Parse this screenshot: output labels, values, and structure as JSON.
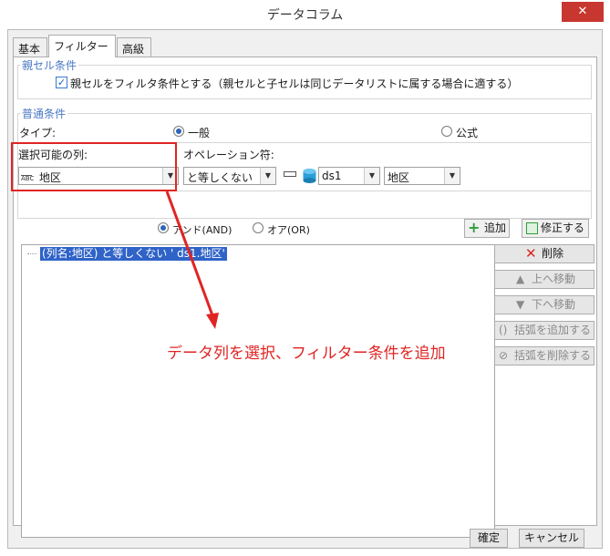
{
  "window": {
    "title": "データコラム",
    "close_glyph": "✕"
  },
  "tabs": [
    {
      "label": "基本"
    },
    {
      "label": "フィルター"
    },
    {
      "label": "高級"
    }
  ],
  "parent_cell": {
    "group_label": "親セル条件",
    "checkbox_checked": true,
    "checkbox_label": "親セルをフィルタ条件とする（親セルと子セルは同じデータリストに属する場合に適する）"
  },
  "normal": {
    "group_label": "普通条件",
    "type_label": "タイプ:",
    "type_general": "一般",
    "type_formula": "公式",
    "selected_type": "一般",
    "column_label": "選択可能の列:",
    "column_value": "地区",
    "column_icon_text": "ABC",
    "operator_label": "オペレーション符:",
    "operator_value": "と等しくない",
    "dataset_value": "ds1",
    "field_value": "地区"
  },
  "logic": {
    "and_label": "アンド(AND)",
    "or_label": "オア(OR)",
    "selected": "AND"
  },
  "actions": {
    "add": "追加",
    "modify": "修正する",
    "delete": "削除",
    "move_up": "上へ移動",
    "move_down": "下へ移動",
    "add_paren": "括弧を追加する",
    "remove_paren": "括弧を削除する"
  },
  "conditions": [
    {
      "text": "(列名:地区) と等しくない ' ds1.地区'"
    }
  ],
  "annotation": "データ列を選択、フィルター条件を追加",
  "footer": {
    "ok": "確定",
    "cancel": "キャンセル"
  },
  "colors": {
    "accent": "#2f63c8",
    "annotation_red": "#e02424",
    "group_label_blue": "#4a77c4",
    "close_red": "#c7372f",
    "add_green": "#2e9e3a",
    "delete_red": "#d9281e"
  }
}
